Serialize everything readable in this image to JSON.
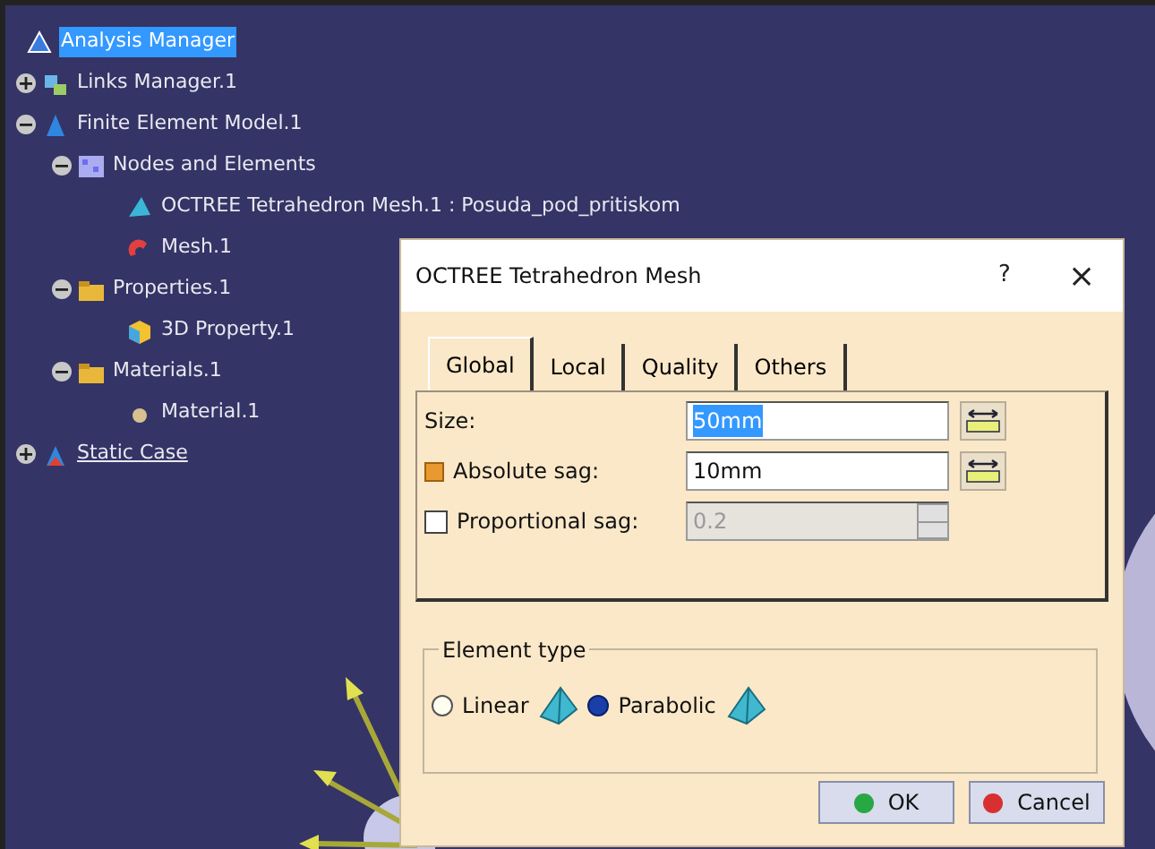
{
  "tree": [
    {
      "label": "Analysis Manager",
      "kind": "manager",
      "selected": true,
      "children": [
        {
          "label": "Links Manager.1",
          "kind": "links",
          "selected": false,
          "expanded": false
        },
        {
          "label": "Finite Element Model.1",
          "kind": "model",
          "selected": false,
          "expanded": true,
          "children": [
            {
              "label": "Nodes and Elements",
              "kind": "nodes",
              "selected": false,
              "expanded": true,
              "children": [
                {
                  "label": "OCTREE Tetrahedron Mesh.1 : Posuda_pod_pritiskom",
                  "kind": "tetra",
                  "selected": false
                },
                {
                  "label": "Mesh.1",
                  "kind": "mesh",
                  "selected": false
                }
              ]
            },
            {
              "label": "Properties.1",
              "kind": "folder",
              "selected": false,
              "expanded": true,
              "children": [
                {
                  "label": "3D Property.1",
                  "kind": "cube",
                  "selected": false
                }
              ]
            },
            {
              "label": "Materials.1",
              "kind": "folder",
              "selected": false,
              "expanded": true,
              "children": [
                {
                  "label": "Material.1",
                  "kind": "material",
                  "selected": false
                }
              ]
            }
          ]
        },
        {
          "label": "Static Case",
          "kind": "case",
          "selected": false,
          "expanded": false,
          "underlined": true
        }
      ]
    }
  ],
  "dialog": {
    "title": "OCTREE Tetrahedron Mesh",
    "help": "?",
    "close": "×",
    "tabs": [
      {
        "label": "Global",
        "selected": true
      },
      {
        "label": "Local",
        "selected": false
      },
      {
        "label": "Quality",
        "selected": false
      },
      {
        "label": "Others",
        "selected": false
      }
    ],
    "fields": [
      {
        "kind": "plain",
        "label": "Size:",
        "value": "50mm",
        "highlighted": true,
        "disabled": false
      },
      {
        "kind": "indicator",
        "label": "Absolute sag:",
        "value": "10mm",
        "checked": true,
        "highlighted": false,
        "disabled": false
      },
      {
        "kind": "checkbox",
        "label": "Proportional sag:",
        "value": "0.2",
        "checked": false,
        "highlighted": false,
        "disabled": true
      }
    ],
    "element_type": {
      "title": "Element type",
      "options": [
        {
          "label": "Linear",
          "selected": false
        },
        {
          "label": "Parabolic",
          "selected": true
        }
      ]
    },
    "buttons": [
      {
        "label": "OK",
        "kind": "ok"
      },
      {
        "label": "Cancel",
        "kind": "cancel"
      }
    ]
  }
}
